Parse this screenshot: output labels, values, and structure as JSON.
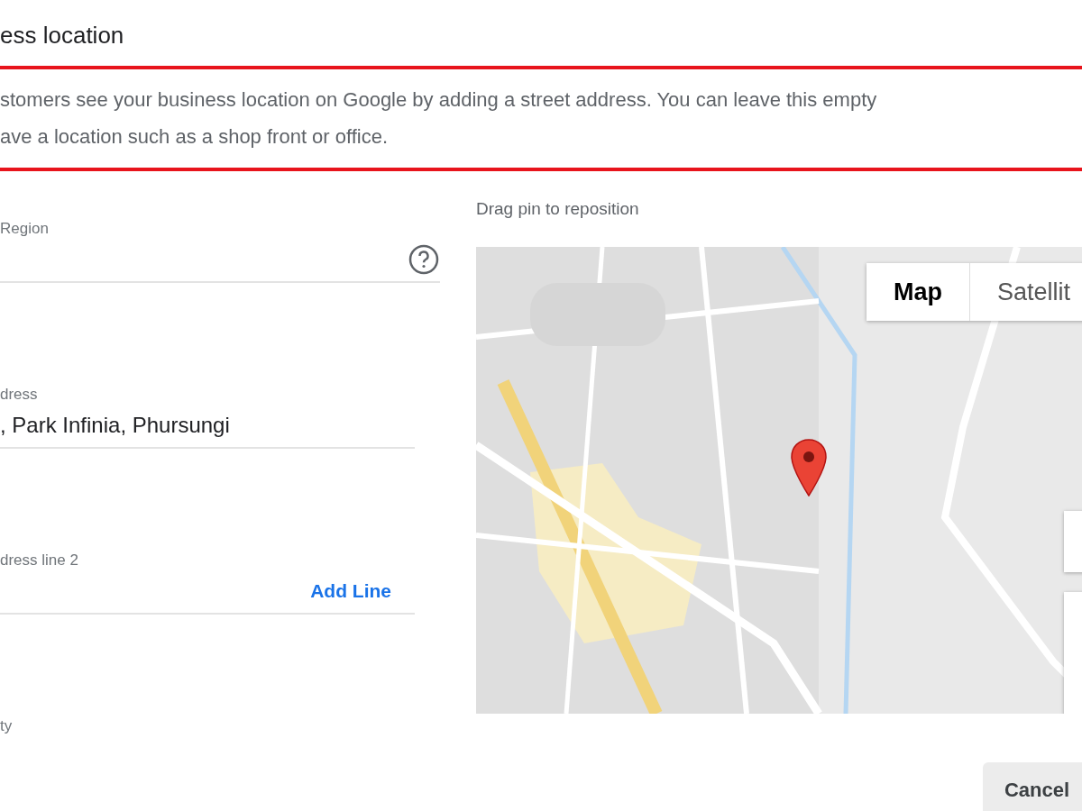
{
  "header": {
    "title": "ess location"
  },
  "description_lines": [
    "stomers see your business location on Google by adding a street address. You can leave this empty",
    "ave a location such as a shop front or office."
  ],
  "fields": [
    {
      "label": "Region",
      "kind": "help"
    },
    {
      "label": "dress",
      "kind": "text",
      "value": ", Park Infinia, Phursungi"
    },
    {
      "label": "dress line 2",
      "kind": "action",
      "action": "Add Line"
    },
    {
      "label": "ty",
      "kind": "open"
    }
  ],
  "map": {
    "caption": "Drag pin to reposition",
    "types": [
      {
        "label": "Map",
        "selected": true
      },
      {
        "label": "Satellit",
        "selected": false
      }
    ]
  },
  "buttons": [
    {
      "label": "Cancel"
    }
  ]
}
